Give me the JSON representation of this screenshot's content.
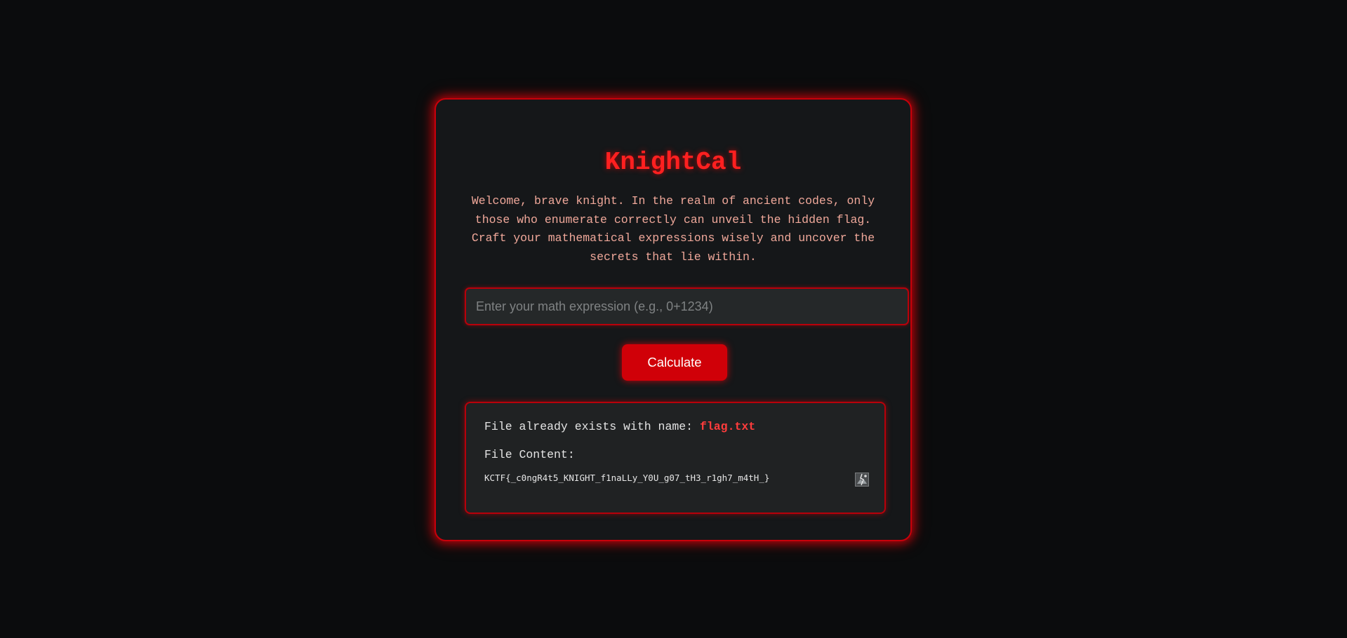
{
  "app": {
    "title": "KnightCal",
    "intro": "Welcome, brave knight. In the realm of ancient codes, only those who enumerate correctly can unveil the hidden flag. Craft your mathematical expressions wisely and uncover the secrets that lie within."
  },
  "form": {
    "expression_placeholder": "Enter your math expression (e.g., 0+1234)",
    "expression_value": "",
    "calculate_label": "Calculate"
  },
  "result": {
    "exists_prefix": "File already exists with name:",
    "file_name": "flag.txt",
    "content_label": "File Content:",
    "file_content": "KCTF{_c0ngR4t5_KNIGHT_f1naLLy_Y0U_g07_tH3_r1gh7_m4tH_}",
    "content_icon": "broken-image-icon"
  },
  "colors": {
    "accent": "#ff2020",
    "button": "#d00008",
    "background": "#0b0c0d",
    "card": "#151719"
  }
}
